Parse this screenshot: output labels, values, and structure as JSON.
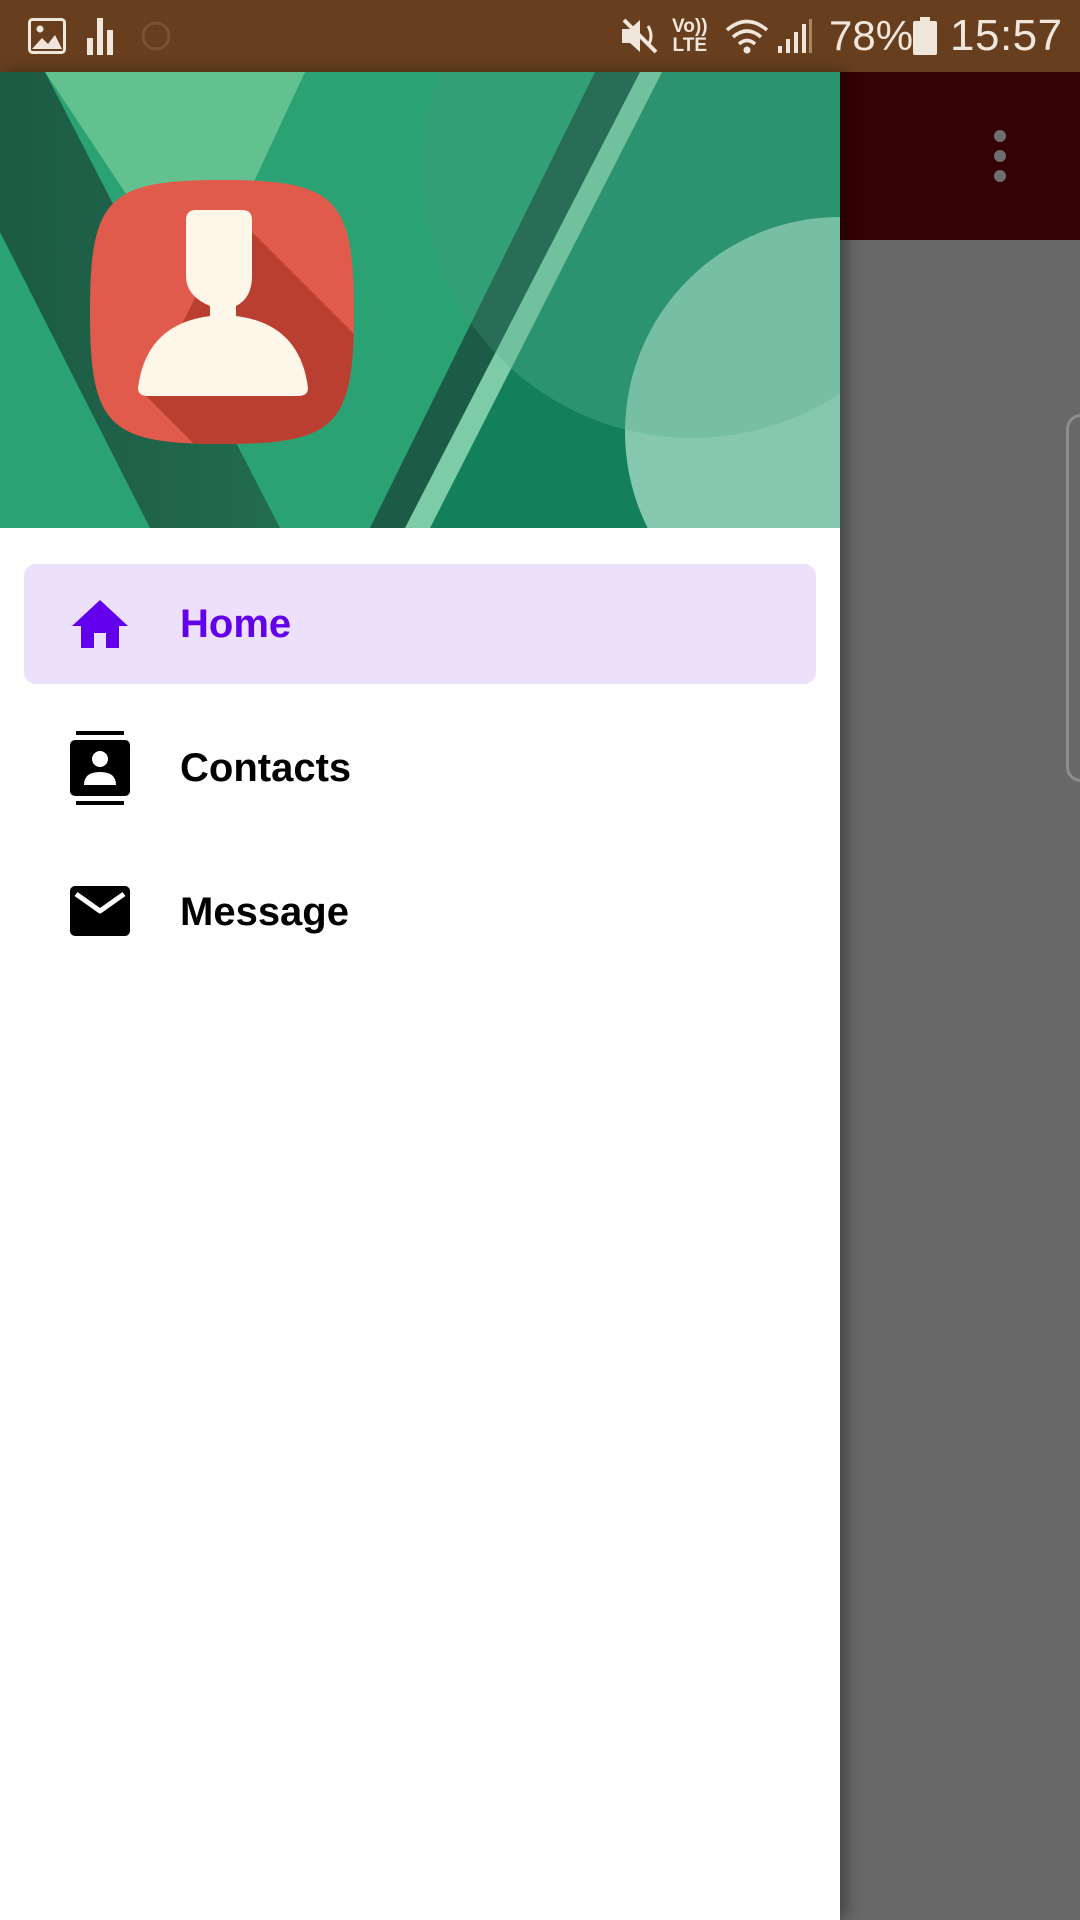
{
  "status_bar": {
    "time": "15:57",
    "battery": "78%",
    "volte_top": "Vo))",
    "volte_bottom": "LTE",
    "icons": [
      "gallery-icon",
      "bar-chart-icon",
      "sync-icon",
      "mute-icon",
      "wifi-icon",
      "signal-icon",
      "battery-icon"
    ],
    "background_color": "#673f1f"
  },
  "app_bar": {
    "more_icon": "more-vert-icon",
    "background_color": "#340104"
  },
  "drawer": {
    "header": {
      "avatar_icon": "contact-avatar-icon",
      "colors": {
        "primary": "#2aa274",
        "dark": "#137f5b",
        "light": "#63c18f",
        "avatar": "#e05b4c"
      }
    },
    "menu": [
      {
        "label": "Home",
        "icon": "home-icon",
        "active": true
      },
      {
        "label": "Contacts",
        "icon": "contacts-icon",
        "active": false
      },
      {
        "label": "Message",
        "icon": "mail-icon",
        "active": false
      }
    ],
    "active_color": "#6200ee",
    "active_background": "#ede0fa"
  }
}
